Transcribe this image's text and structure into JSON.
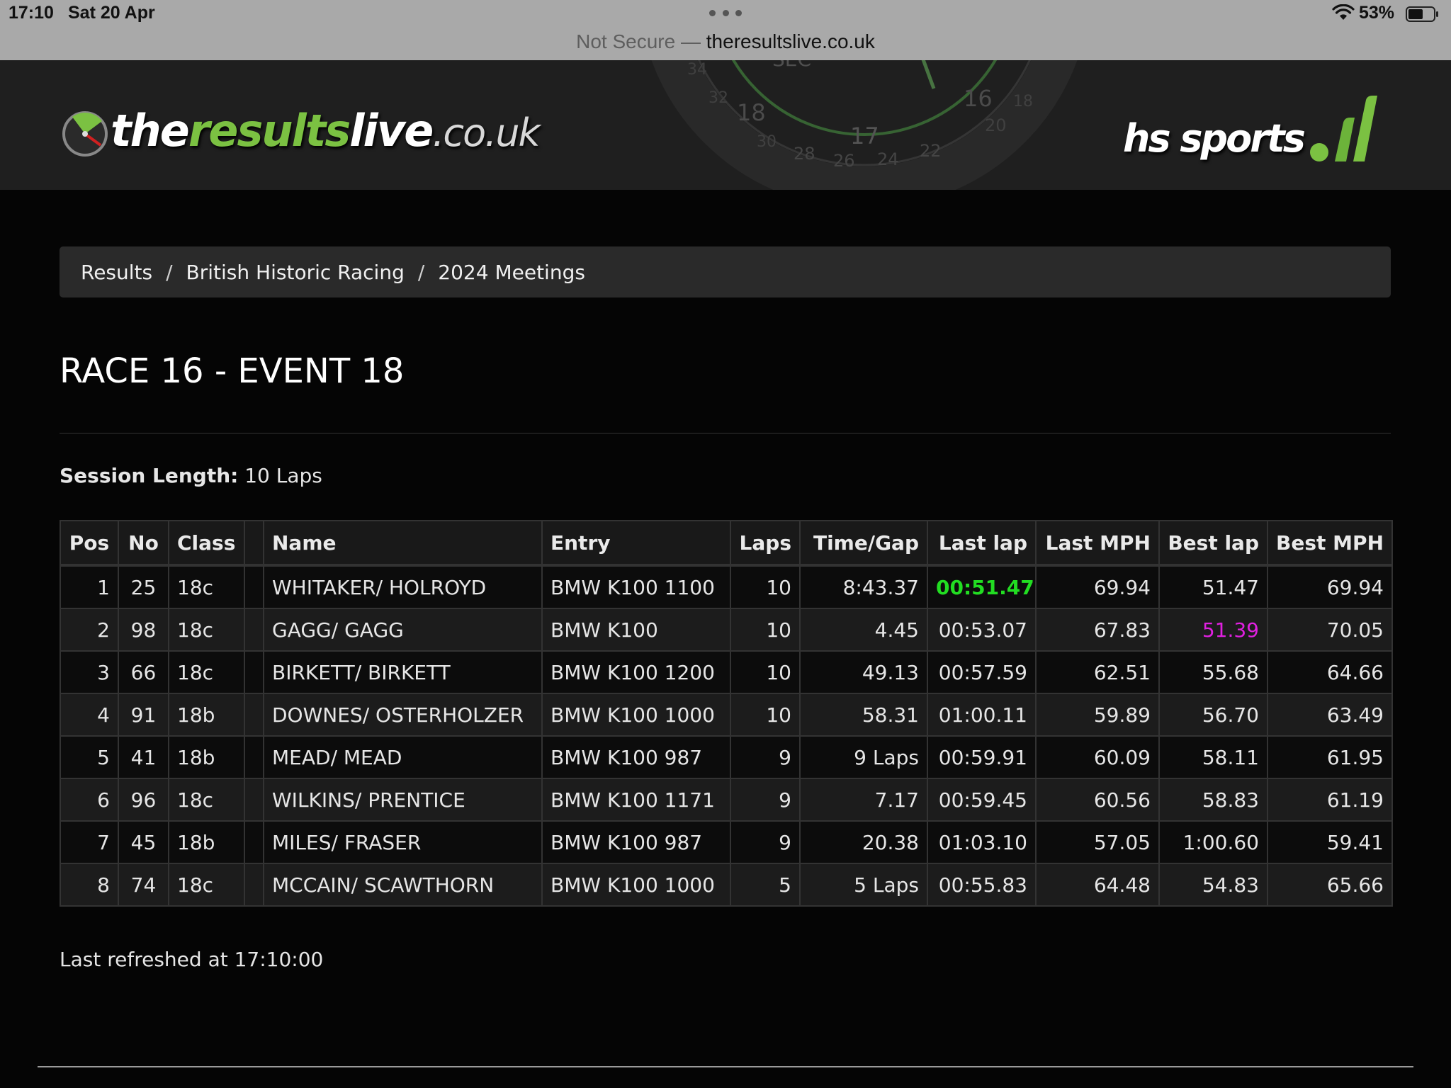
{
  "status_bar": {
    "time": "17:10",
    "date": "Sat 20 Apr",
    "battery": "53%"
  },
  "address_bar": {
    "security": "Not Secure",
    "separator": "—",
    "domain": "theresultslive.co.uk"
  },
  "header": {
    "logo": {
      "the": "the",
      "results": "results",
      "live": "live",
      "tld": ".co.uk"
    },
    "sponsor": "hs sports",
    "dial_numbers": [
      "SEC",
      "20",
      "17",
      "16",
      "18",
      "28",
      "26",
      "24",
      "22",
      "20",
      "18",
      "34",
      "32",
      "30"
    ]
  },
  "breadcrumb": {
    "items": [
      "Results",
      "British Historic Racing",
      "2024 Meetings"
    ],
    "separator": "/"
  },
  "page": {
    "title": "RACE 16 - EVENT 18",
    "session_label": "Session Length:",
    "session_value": "10 Laps",
    "refreshed": "Last refreshed at 17:10:00"
  },
  "table": {
    "headers": [
      "Pos",
      "No",
      "Class",
      "",
      "Name",
      "Entry",
      "Laps",
      "Time/Gap",
      "Last lap",
      "Last MPH",
      "Best lap",
      "Best MPH"
    ],
    "rows": [
      [
        "1",
        "25",
        "18c",
        "",
        "WHITAKER/ HOLROYD",
        "BMW K100 1100",
        "10",
        "8:43.37",
        "00:51.47",
        "69.94",
        "51.47",
        "69.94"
      ],
      [
        "2",
        "98",
        "18c",
        "",
        "GAGG/ GAGG",
        "BMW K100",
        "10",
        "4.45",
        "00:53.07",
        "67.83",
        "51.39",
        "70.05"
      ],
      [
        "3",
        "66",
        "18c",
        "",
        "BIRKETT/ BIRKETT",
        "BMW K100 1200",
        "10",
        "49.13",
        "00:57.59",
        "62.51",
        "55.68",
        "64.66"
      ],
      [
        "4",
        "91",
        "18b",
        "",
        "DOWNES/ OSTERHOLZER",
        "BMW K100 1000",
        "10",
        "58.31",
        "01:00.11",
        "59.89",
        "56.70",
        "63.49"
      ],
      [
        "5",
        "41",
        "18b",
        "",
        "MEAD/ MEAD",
        "BMW K100 987",
        "9",
        "9 Laps",
        "00:59.91",
        "60.09",
        "58.11",
        "61.95"
      ],
      [
        "6",
        "96",
        "18c",
        "",
        "WILKINS/ PRENTICE",
        "BMW K100 1171",
        "9",
        "7.17",
        "00:59.45",
        "60.56",
        "58.83",
        "61.19"
      ],
      [
        "7",
        "45",
        "18b",
        "",
        "MILES/ FRASER",
        "BMW K100 987",
        "9",
        "20.38",
        "01:03.10",
        "57.05",
        "1:00.60",
        "59.41"
      ],
      [
        "8",
        "74",
        "18c",
        "",
        "MCCAIN/ SCAWTHORN",
        "BMW K100 1000",
        "5",
        "5 Laps",
        "00:55.83",
        "64.48",
        "54.83",
        "65.66"
      ]
    ],
    "highlights": {
      "fastest_last_lap": {
        "row": 0,
        "col": 8,
        "color": "#22dd22"
      },
      "fastest_best_lap": {
        "row": 1,
        "col": 10,
        "color": "#e020e0"
      }
    }
  },
  "colors": {
    "brand_green": "#7bc142",
    "background": "#050505",
    "header_bg": "#1f1f1f"
  }
}
